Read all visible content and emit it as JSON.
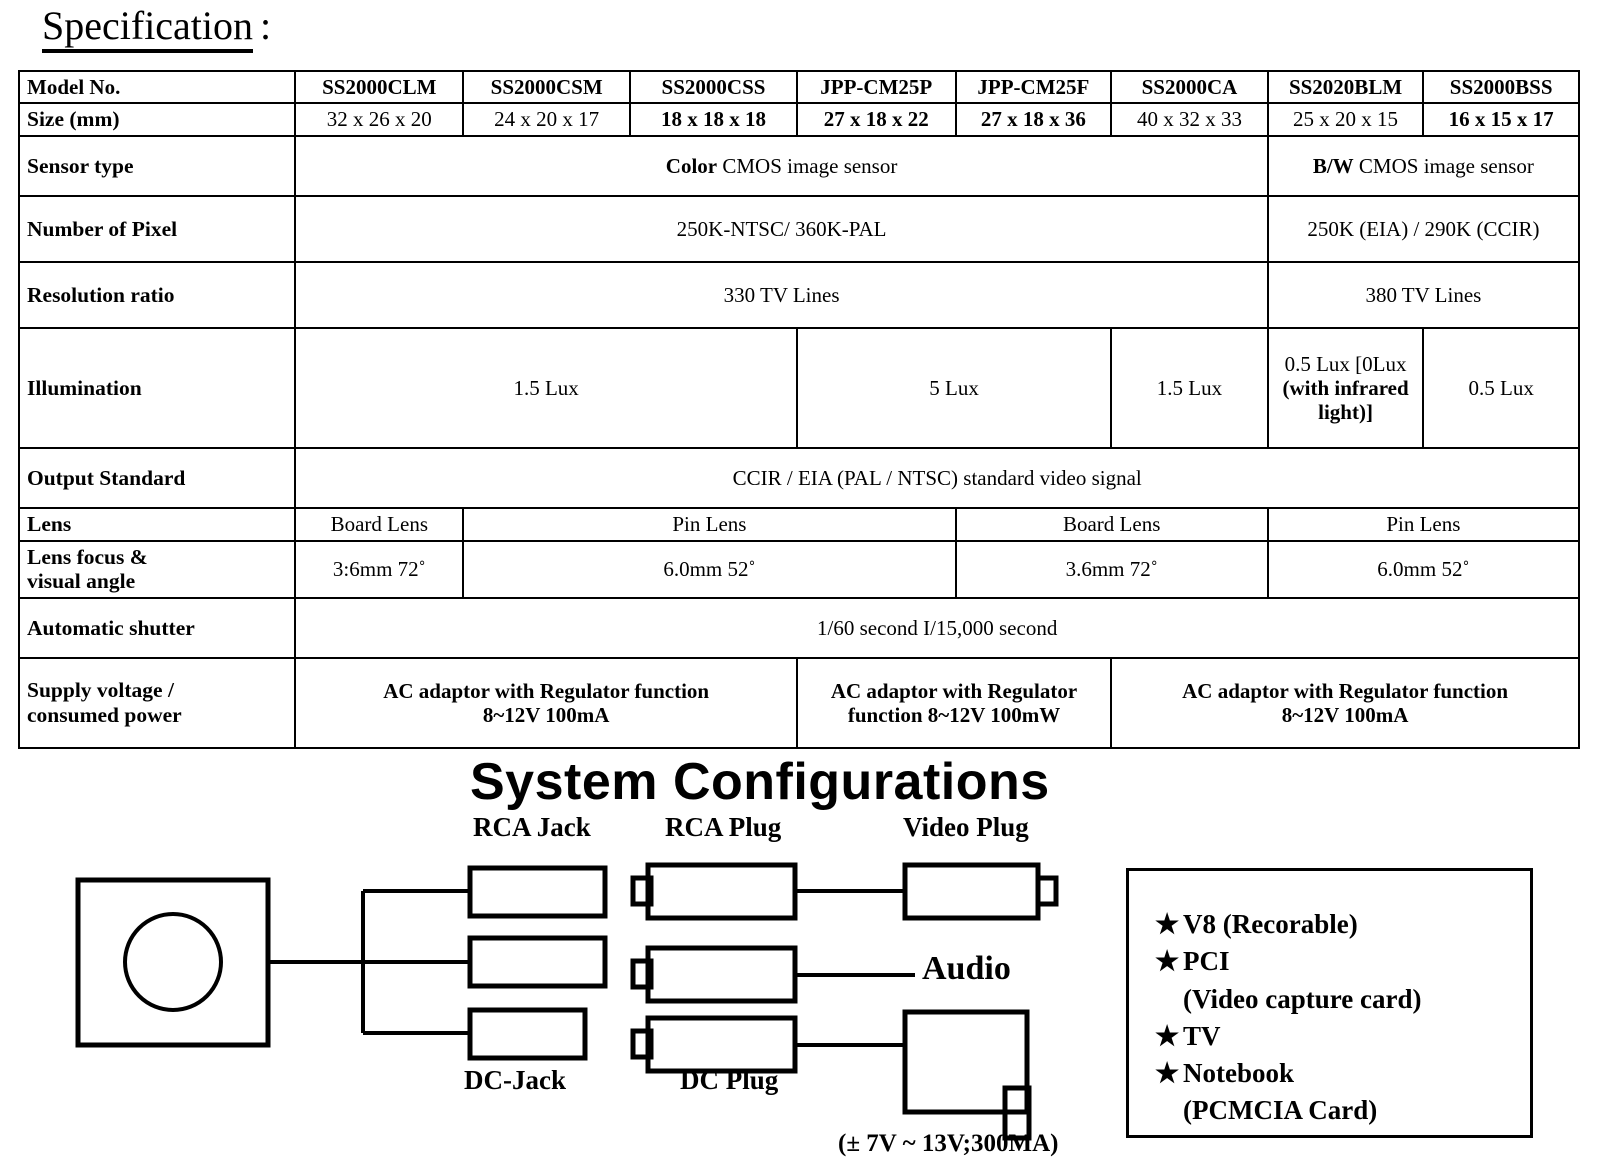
{
  "spec": {
    "title_word": "Specification",
    "title_colon": ":",
    "row_labels": {
      "model": "Model No.",
      "size": "Size (mm)",
      "sensor": "Sensor type",
      "pixel": "Number of Pixel",
      "resolution": "Resolution ratio",
      "illumination": "Illumination",
      "output": "Output Standard",
      "lens": "Lens",
      "lens_focus_l1": "Lens focus &",
      "lens_focus_l2": "visual angle",
      "shutter": "Automatic shutter",
      "supply_l1": "Supply voltage /",
      "supply_l2": "consumed power"
    },
    "models": [
      "SS2000CLM",
      "SS2000CSM",
      "SS2000CSS",
      "JPP-CM25P",
      "JPP-CM25F",
      "SS2000CA",
      "SS2020BLM",
      "SS2000BSS"
    ],
    "sizes": [
      "32 x 26 x 20",
      "24 x 20 x 17",
      "18 x 18 x 18",
      "27 x 18 x 22",
      "27 x 18 x 36",
      "40 x 32 x 33",
      "25 x 20 x 15",
      "16 x 15 x 17"
    ],
    "sensor": {
      "color_bold": "Color",
      "color_rest": " CMOS image sensor",
      "bw_bold": "B/W",
      "bw_rest": " CMOS image sensor"
    },
    "pixel": {
      "color": "250K-NTSC/ 360K-PAL",
      "bw": "250K (EIA) / 290K (CCIR)"
    },
    "resolution": {
      "color": "330 TV Lines",
      "bw": "380 TV Lines"
    },
    "illumination": {
      "c1": "1.5 Lux",
      "c2": "5 Lux",
      "c3": "1.5 Lux",
      "c4_l1": "0.5 Lux [0Lux",
      "c4_l2": "(with infrared",
      "c4_l3": "light)]",
      "c5": "0.5 Lux"
    },
    "output_standard": "CCIR / EIA (PAL / NTSC) standard video signal",
    "lens": {
      "board1": "Board Lens",
      "pin1": "Pin Lens",
      "board2": "Board Lens",
      "pin2": "Pin Lens"
    },
    "lens_focus": {
      "f1": "3:6mm 72˚",
      "f2": "6.0mm 52˚",
      "f3": "3.6mm 72˚",
      "f4": "6.0mm 52˚"
    },
    "shutter_value": "1/60 second   I/15,000 second",
    "supply": {
      "g1_l1": "AC adaptor with Regulator function",
      "g1_l2": "8~12V   100mA",
      "g2_l1": "AC adaptor with Regulator",
      "g2_l2": "function 8~12V    100mW",
      "g3_l1": "AC adaptor with Regulator function",
      "g3_l2": "8~12V  100mA"
    }
  },
  "system": {
    "heading": "System Configurations",
    "labels": {
      "rca_jack": "RCA Jack",
      "rca_plug": "RCA Plug",
      "video_plug": "Video Plug",
      "audio": "Audio",
      "dc_jack": "DC-Jack",
      "dc_plug": "DC Plug",
      "voltage": "(± 7V ~ 13V;300MA)"
    },
    "devices": [
      {
        "star": "★",
        "text": "V8 (Recorable)",
        "sub": ""
      },
      {
        "star": "★",
        "text": "PCI",
        "sub": "(Video capture card)"
      },
      {
        "star": "★",
        "text": "TV",
        "sub": ""
      },
      {
        "star": "★",
        "text": "Notebook",
        "sub": "(PCMCIA Card)"
      }
    ]
  }
}
